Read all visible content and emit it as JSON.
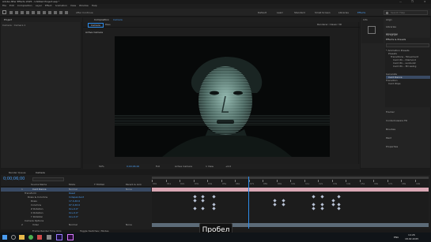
{
  "titlebar": {
    "title": "Adobe After Effects 2025 - Untitled Project.aep *",
    "win_min": "—",
    "win_max": "❐",
    "win_close": "✕"
  },
  "menu": [
    "File",
    "Edit",
    "Composition",
    "Layer",
    "Effect",
    "Animation",
    "View",
    "Window",
    "Help"
  ],
  "toolbar": {
    "snapping": "After Continue",
    "workspaces": [
      "Default",
      "Learn",
      "Standard",
      "Small Screen",
      "Libraries"
    ],
    "active_workspace": "Effects",
    "search_placeholder": "Search Help"
  },
  "project_panel": {
    "tab": "Project",
    "breadcrumb": "Camera : Camera 1"
  },
  "comp_panel": {
    "tab": "Composition",
    "tab_name": "Camera",
    "sub_tabs": [
      "Camera",
      "Pass"
    ],
    "view_label": "Active Camera",
    "renderer": "Renderer: Classic 3D",
    "footer": {
      "zoom": "50%",
      "time": "0;00;06;00",
      "resolution": "Full",
      "view": "Active Camera",
      "views": "1 View",
      "plus": "+0.0"
    }
  },
  "right_panels": {
    "headers": [
      "Info",
      "Audio",
      "Preview",
      "Effects & Presets"
    ],
    "selected_tab": "Effects & Presets",
    "search_value": "",
    "tree": [
      {
        "label": "* Animation Presets",
        "depth": 0
      },
      {
        "label": "Presets",
        "depth": 1
      },
      {
        "label": "Transitions - Movement",
        "depth": 2
      },
      {
        "label": "Card Wi... Diamond",
        "depth": 3
      },
      {
        "label": "Card Wi... sunburst",
        "depth": 3
      },
      {
        "label": "Card Wi... 3D swing",
        "depth": 3
      },
      {
        "label": "Generate",
        "depth": 0
      },
      {
        "label": "Card Dance",
        "depth": 1
      },
      {
        "label": "Transition",
        "depth": 0
      },
      {
        "label": "Card Wipe",
        "depth": 1
      }
    ],
    "side_tabs": [
      "Align",
      "Libraries",
      "Character",
      "Paragraph",
      "Tracker",
      "Content-Aware Fill",
      "Brushes",
      "Paint",
      "Properties"
    ]
  },
  "timeline": {
    "tabs": [
      "Render Queue",
      "Camera"
    ],
    "time": "0;00;06;00",
    "columns": [
      "Source Name",
      "Mode",
      "T TrkMat",
      "Parent & Link"
    ],
    "layers": [
      {
        "num": "1",
        "name": "Card Dance",
        "mode": "Normal",
        "parent": "None",
        "selected": true
      },
      {
        "num": "",
        "name": "Transform",
        "mode": "Reset",
        "parent": "",
        "selected": false
      },
      {
        "num": "",
        "name": "Rows & Columns",
        "mode": "Independent",
        "parent": "",
        "selected": false
      },
      {
        "num": "",
        "name": "Rows",
        "mode": "17.0,40.0",
        "parent": "",
        "selected": false
      },
      {
        "num": "",
        "name": "Columns",
        "mode": "97.0,40.0",
        "parent": "",
        "selected": false
      },
      {
        "num": "",
        "name": "Z Rotation",
        "mode": "0x+0.0°",
        "parent": "",
        "selected": false
      },
      {
        "num": "",
        "name": "X Rotation",
        "mode": "0x+0.0°",
        "parent": "",
        "selected": false
      },
      {
        "num": "",
        "name": "Y Rotation",
        "mode": "0x+0.0°",
        "parent": "",
        "selected": false
      },
      {
        "num": "",
        "name": "Camera Options",
        "mode": "",
        "parent": "",
        "selected": false
      },
      {
        "num": "2",
        "name": "Video",
        "mode": "Normal",
        "parent": "None",
        "selected": false
      }
    ],
    "ruler": [
      "00s",
      "01s",
      "02s",
      "03s",
      "04s",
      "05s",
      "06s",
      "07s",
      "08s",
      "09s",
      "10s",
      "11s",
      "12s",
      "13s",
      "14s",
      "15s",
      "16s",
      "17s",
      "18s",
      "19s"
    ],
    "playhead_fraction": 0.35,
    "footer": "Toggle Switches / Modes",
    "frame_render": "Frame Render Time 0ms"
  },
  "overlay": {
    "label": "Пробел"
  },
  "taskbar": {
    "time": "14:26",
    "date": "18.02.2025",
    "lang": "ENG"
  },
  "colors": {
    "accent": "#2d8ceb",
    "layer_bar": "#d9a7b4",
    "selected_row": "#394a63"
  }
}
